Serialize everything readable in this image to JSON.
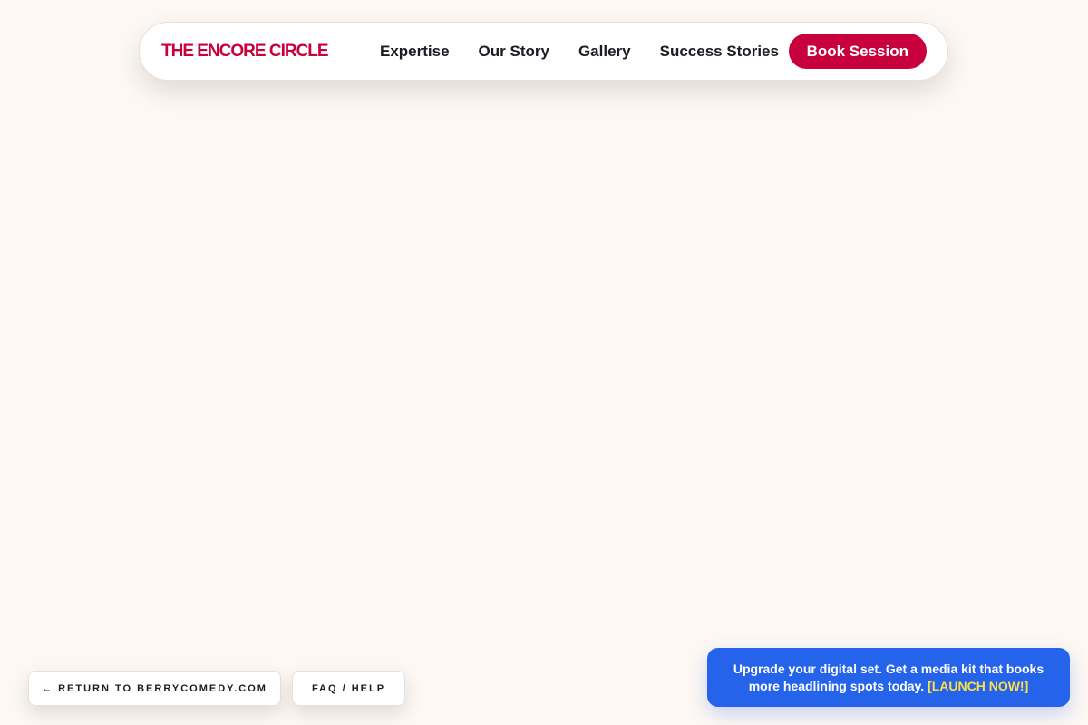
{
  "header": {
    "brand": "THE ENCORE CIRCLE",
    "nav": [
      "Expertise",
      "Our Story",
      "Gallery",
      "Success Stories"
    ],
    "cta": "Book Session"
  },
  "footer": {
    "return_label": "← RETURN TO BERRYCOMEDY.COM",
    "faq_label": "FAQ / HELP"
  },
  "promo": {
    "text": "Upgrade your digital set. Get a media kit that books more headlining spots today.",
    "link": "[LAUNCH NOW!]"
  },
  "colors": {
    "background": "#fdf8f3",
    "brand": "#c8003c",
    "promo": "#2563eb",
    "promo_link": "#fde047"
  }
}
